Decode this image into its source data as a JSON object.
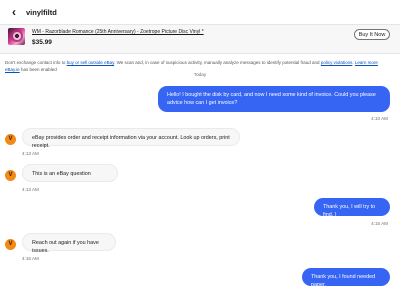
{
  "header": {
    "back_icon": "chevron-left-icon",
    "username": "vinylfiltd"
  },
  "listing": {
    "title": "WM - Razorblade Romance (25th Anniversary) - Zoetrope Picture Disc Vinyl *",
    "price": "$35.99",
    "buy_label": "Buy It Now"
  },
  "notice": {
    "text_before": "Don't exchange contact info to ",
    "link1": "buy or sell outside eBay",
    "text_middle": ". We scan and, in case of suspicious activity, manually analyze messages to identify potential fraud and ",
    "link2": "policy violations",
    "text_after": ". ",
    "link3": "Learn more",
    "link4": "eBay.ie",
    "text_end": " has been enabled"
  },
  "day_separator": "Today",
  "avatar_letter": "V",
  "messages": [
    {
      "direction": "out",
      "text": "Hello! I bought the disk by card, and now I need some kind of invoice. Could you please advice how can I get invoice?",
      "time": "4:10 AM"
    },
    {
      "direction": "in",
      "text": "eBay provides order and receipt information via your account. Look up orders, print receipt.",
      "time": "4:13 AM"
    },
    {
      "direction": "in",
      "text": "This is an eBay question",
      "time": "4:13 AM"
    },
    {
      "direction": "out",
      "text": "Thank you, I will try to find. )",
      "time": "4:15 AM"
    },
    {
      "direction": "in",
      "text": "Reach out again if you have issues.",
      "time": "4:16 AM"
    },
    {
      "direction": "out",
      "text": "Thank you, I found needed paper.",
      "time": ""
    }
  ],
  "colors": {
    "accent": "#3665f3",
    "avatar": "#f18a16",
    "link": "#0654ba"
  }
}
